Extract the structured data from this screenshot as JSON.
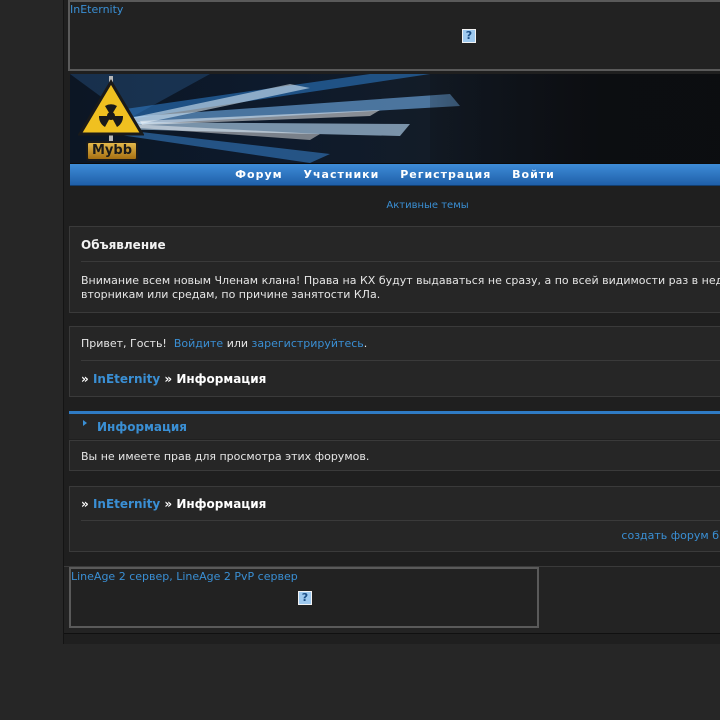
{
  "top_ad": {
    "link_text": "InEternity",
    "icon": "question-mark-icon",
    "icon_glyph": "?"
  },
  "banner": {
    "badge": "Mybb",
    "icon": "radiation-sign-icon"
  },
  "nav": {
    "items": [
      "Форум",
      "Участники",
      "Регистрация",
      "Войти"
    ]
  },
  "active_topics_link": "Активные темы",
  "notice": {
    "title": "Объявление",
    "line1": "Внимание всем новым Членам клана! Права на КХ будут выдаваться не сразу, а по всей видимости раз в нед",
    "line2": "вторникам или средам, по причине занятости КЛа."
  },
  "welcome": {
    "greeting": "Привет, Гость!",
    "login_link": "Войдите",
    "or_text": "или",
    "register_link": "зарегистрируйтесь",
    "period": "."
  },
  "breadcrumb": {
    "separator": "»",
    "forum_link": "InEternity",
    "current": "Информация"
  },
  "info_section": {
    "title": "Информация",
    "message": "Вы не имеете прав для просмотра этих форумов."
  },
  "footer": {
    "create_forum_link": "создать форум б"
  },
  "bottom_ad": {
    "link_text": "LineAge 2 сервер, LineAge 2 PvP сервер",
    "icon": "question-mark-icon",
    "icon_glyph": "?"
  },
  "colors": {
    "link": "#3a8fd4",
    "nav_bar": "#2f7bc4",
    "background": "#1f1f1f",
    "panel": "#262626"
  }
}
